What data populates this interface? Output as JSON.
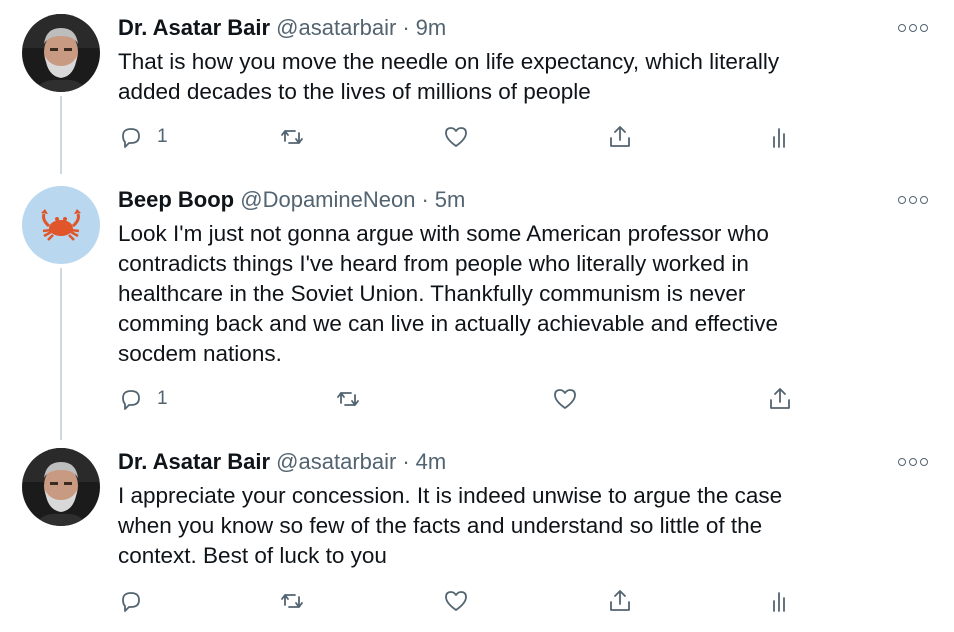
{
  "tweets": [
    {
      "name": "Dr. Asatar Bair",
      "handle": "@asatarbair",
      "separator": "·",
      "time": "9m",
      "text": "That is how you move the needle on life expectancy, which literally\nadded decades to the lives of millions of people",
      "reply_count": "1",
      "avatar_icon": "bearded-man-avatar"
    },
    {
      "name": "Beep Boop",
      "handle": "@DopamineNeon",
      "separator": "·",
      "time": "5m",
      "text": "Look I'm just not gonna argue with some American professor who\ncontradicts things I've heard from people who literally worked in\nhealthcare in the Soviet Union. Thankfully communism is never\ncomming back and we can live in actually achievable and effective\nsocdem nations.",
      "reply_count": "1",
      "avatar_icon": "crab-avatar"
    },
    {
      "name": "Dr. Asatar Bair",
      "handle": "@asatarbair",
      "separator": "·",
      "time": "4m",
      "text": "I appreciate your concession. It is indeed unwise to argue the case\nwhen you know so few of the facts and understand so little of the\ncontext. Best of luck to you",
      "reply_count": "",
      "avatar_icon": "bearded-man-avatar"
    }
  ],
  "colors": {
    "text": "#0f1419",
    "secondary": "#536471",
    "thread_line": "#cfd9de",
    "crab_avatar_bg": "#b9d7ef",
    "crab": "#e0562a"
  }
}
